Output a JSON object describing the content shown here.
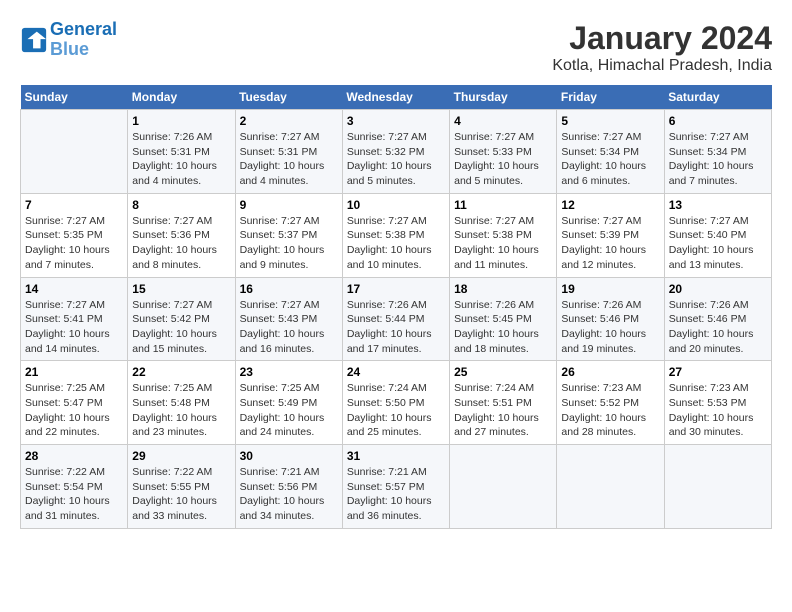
{
  "header": {
    "logo_line1": "General",
    "logo_line2": "Blue",
    "month": "January 2024",
    "location": "Kotla, Himachal Pradesh, India"
  },
  "days_of_week": [
    "Sunday",
    "Monday",
    "Tuesday",
    "Wednesday",
    "Thursday",
    "Friday",
    "Saturday"
  ],
  "weeks": [
    [
      {
        "day": "",
        "info": ""
      },
      {
        "day": "1",
        "info": "Sunrise: 7:26 AM\nSunset: 5:31 PM\nDaylight: 10 hours\nand 4 minutes."
      },
      {
        "day": "2",
        "info": "Sunrise: 7:27 AM\nSunset: 5:31 PM\nDaylight: 10 hours\nand 4 minutes."
      },
      {
        "day": "3",
        "info": "Sunrise: 7:27 AM\nSunset: 5:32 PM\nDaylight: 10 hours\nand 5 minutes."
      },
      {
        "day": "4",
        "info": "Sunrise: 7:27 AM\nSunset: 5:33 PM\nDaylight: 10 hours\nand 5 minutes."
      },
      {
        "day": "5",
        "info": "Sunrise: 7:27 AM\nSunset: 5:34 PM\nDaylight: 10 hours\nand 6 minutes."
      },
      {
        "day": "6",
        "info": "Sunrise: 7:27 AM\nSunset: 5:34 PM\nDaylight: 10 hours\nand 7 minutes."
      }
    ],
    [
      {
        "day": "7",
        "info": "Sunrise: 7:27 AM\nSunset: 5:35 PM\nDaylight: 10 hours\nand 7 minutes."
      },
      {
        "day": "8",
        "info": "Sunrise: 7:27 AM\nSunset: 5:36 PM\nDaylight: 10 hours\nand 8 minutes."
      },
      {
        "day": "9",
        "info": "Sunrise: 7:27 AM\nSunset: 5:37 PM\nDaylight: 10 hours\nand 9 minutes."
      },
      {
        "day": "10",
        "info": "Sunrise: 7:27 AM\nSunset: 5:38 PM\nDaylight: 10 hours\nand 10 minutes."
      },
      {
        "day": "11",
        "info": "Sunrise: 7:27 AM\nSunset: 5:38 PM\nDaylight: 10 hours\nand 11 minutes."
      },
      {
        "day": "12",
        "info": "Sunrise: 7:27 AM\nSunset: 5:39 PM\nDaylight: 10 hours\nand 12 minutes."
      },
      {
        "day": "13",
        "info": "Sunrise: 7:27 AM\nSunset: 5:40 PM\nDaylight: 10 hours\nand 13 minutes."
      }
    ],
    [
      {
        "day": "14",
        "info": "Sunrise: 7:27 AM\nSunset: 5:41 PM\nDaylight: 10 hours\nand 14 minutes."
      },
      {
        "day": "15",
        "info": "Sunrise: 7:27 AM\nSunset: 5:42 PM\nDaylight: 10 hours\nand 15 minutes."
      },
      {
        "day": "16",
        "info": "Sunrise: 7:27 AM\nSunset: 5:43 PM\nDaylight: 10 hours\nand 16 minutes."
      },
      {
        "day": "17",
        "info": "Sunrise: 7:26 AM\nSunset: 5:44 PM\nDaylight: 10 hours\nand 17 minutes."
      },
      {
        "day": "18",
        "info": "Sunrise: 7:26 AM\nSunset: 5:45 PM\nDaylight: 10 hours\nand 18 minutes."
      },
      {
        "day": "19",
        "info": "Sunrise: 7:26 AM\nSunset: 5:46 PM\nDaylight: 10 hours\nand 19 minutes."
      },
      {
        "day": "20",
        "info": "Sunrise: 7:26 AM\nSunset: 5:46 PM\nDaylight: 10 hours\nand 20 minutes."
      }
    ],
    [
      {
        "day": "21",
        "info": "Sunrise: 7:25 AM\nSunset: 5:47 PM\nDaylight: 10 hours\nand 22 minutes."
      },
      {
        "day": "22",
        "info": "Sunrise: 7:25 AM\nSunset: 5:48 PM\nDaylight: 10 hours\nand 23 minutes."
      },
      {
        "day": "23",
        "info": "Sunrise: 7:25 AM\nSunset: 5:49 PM\nDaylight: 10 hours\nand 24 minutes."
      },
      {
        "day": "24",
        "info": "Sunrise: 7:24 AM\nSunset: 5:50 PM\nDaylight: 10 hours\nand 25 minutes."
      },
      {
        "day": "25",
        "info": "Sunrise: 7:24 AM\nSunset: 5:51 PM\nDaylight: 10 hours\nand 27 minutes."
      },
      {
        "day": "26",
        "info": "Sunrise: 7:23 AM\nSunset: 5:52 PM\nDaylight: 10 hours\nand 28 minutes."
      },
      {
        "day": "27",
        "info": "Sunrise: 7:23 AM\nSunset: 5:53 PM\nDaylight: 10 hours\nand 30 minutes."
      }
    ],
    [
      {
        "day": "28",
        "info": "Sunrise: 7:22 AM\nSunset: 5:54 PM\nDaylight: 10 hours\nand 31 minutes."
      },
      {
        "day": "29",
        "info": "Sunrise: 7:22 AM\nSunset: 5:55 PM\nDaylight: 10 hours\nand 33 minutes."
      },
      {
        "day": "30",
        "info": "Sunrise: 7:21 AM\nSunset: 5:56 PM\nDaylight: 10 hours\nand 34 minutes."
      },
      {
        "day": "31",
        "info": "Sunrise: 7:21 AM\nSunset: 5:57 PM\nDaylight: 10 hours\nand 36 minutes."
      },
      {
        "day": "",
        "info": ""
      },
      {
        "day": "",
        "info": ""
      },
      {
        "day": "",
        "info": ""
      }
    ]
  ]
}
